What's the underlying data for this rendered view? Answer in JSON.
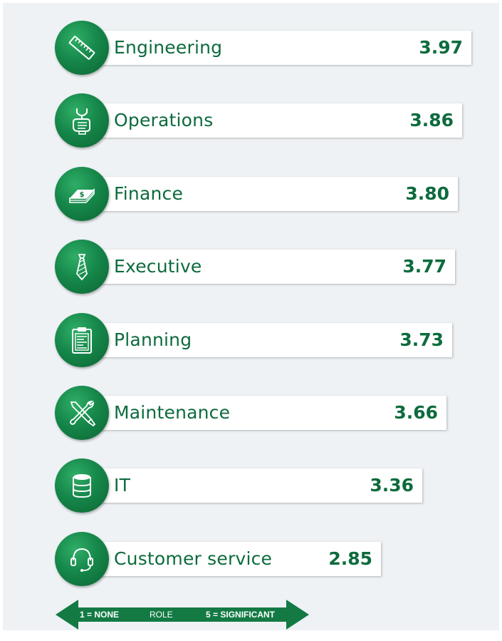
{
  "chart_data": {
    "type": "bar",
    "orientation": "horizontal",
    "categories": [
      "Engineering",
      "Operations",
      "Finance",
      "Executive",
      "Planning",
      "Maintenance",
      "IT",
      "Customer service"
    ],
    "values": [
      3.97,
      3.86,
      3.8,
      3.77,
      3.73,
      3.66,
      3.36,
      2.85
    ],
    "value_labels": [
      "3.97",
      "3.86",
      "3.80",
      "3.77",
      "3.73",
      "3.66",
      "3.36",
      "2.85"
    ],
    "icons": [
      "ruler-icon",
      "wrench-hand-icon",
      "money-stack-icon",
      "necktie-icon",
      "clipboard-icon",
      "tools-icon",
      "database-icon",
      "headset-icon"
    ],
    "colors": {
      "accent": "#0d6b3d",
      "circle": "#16874a",
      "bar": "#ffffff",
      "background": "#eef2f5"
    }
  },
  "scale": {
    "left_label": "1 = NONE",
    "center_label": "ROLE",
    "right_label": "5 = SIGNIFICANT"
  }
}
